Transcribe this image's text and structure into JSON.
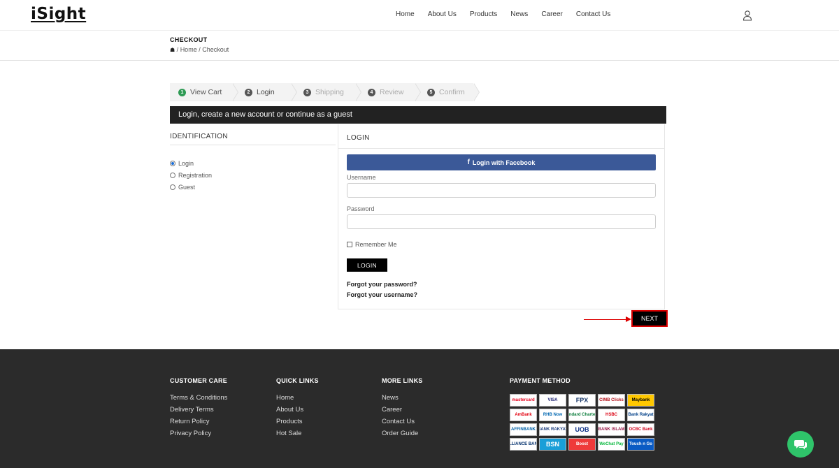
{
  "header": {
    "logo": "iSight",
    "nav": [
      "Home",
      "About Us",
      "Products",
      "News",
      "Career",
      "Contact Us"
    ]
  },
  "titlebar": {
    "title": "CHECKOUT",
    "breadcrumb": [
      "Home",
      "Checkout"
    ]
  },
  "steps": [
    {
      "num": "1",
      "label": "View Cart",
      "state": "done"
    },
    {
      "num": "2",
      "label": "Login",
      "state": "active"
    },
    {
      "num": "3",
      "label": "Shipping",
      "state": "pending"
    },
    {
      "num": "4",
      "label": "Review",
      "state": "pending"
    },
    {
      "num": "5",
      "label": "Confirm",
      "state": "pending"
    }
  ],
  "banner": "Login, create a new account or continue as a guest",
  "identification": {
    "title": "IDENTIFICATION",
    "options": [
      {
        "label": "Login",
        "selected": true
      },
      {
        "label": "Registration",
        "selected": false
      },
      {
        "label": "Guest",
        "selected": false
      }
    ]
  },
  "login": {
    "title": "LOGIN",
    "facebook": "Login with Facebook",
    "username_label": "Username",
    "username_value": "",
    "password_label": "Password",
    "password_value": "",
    "remember": "Remember Me",
    "button": "LOGIN",
    "forgot_password": "Forgot your password?",
    "forgot_username": "Forgot your username?"
  },
  "next_button": "NEXT",
  "footer": {
    "customer_care": {
      "title": "CUSTOMER CARE",
      "links": [
        "Terms & Conditions",
        "Delivery Terms",
        "Return Policy",
        "Privacy Policy"
      ]
    },
    "quick_links": {
      "title": "QUICK LINKS",
      "links": [
        "Home",
        "About Us",
        "Products",
        "Hot Sale"
      ]
    },
    "more_links": {
      "title": "MORE LINKS",
      "links": [
        "News",
        "Career",
        "Contact Us",
        "Order Guide"
      ]
    },
    "payment": {
      "title": "PAYMENT METHOD",
      "methods": [
        "mastercard",
        "VISA",
        "FPX",
        "CIMB Clicks",
        "Maybank",
        "AmBank",
        "RHB Now",
        "Standard Chartered",
        "HSBC",
        "Bank Rakyat",
        "AFFINBANK",
        "BANK RAKYAT",
        "UOB",
        "BANK ISLAM",
        "OCBC Bank",
        "ALLIANCE BANK",
        "BSN",
        "Boost",
        "WeChat Pay",
        "Touch n Go"
      ]
    }
  },
  "colors": {
    "facebook": "#3b5998",
    "step_done": "#2e9a54",
    "footer_bg": "#2b2b2b",
    "chat": "#2fc46a",
    "highlight": "#dd0000"
  }
}
